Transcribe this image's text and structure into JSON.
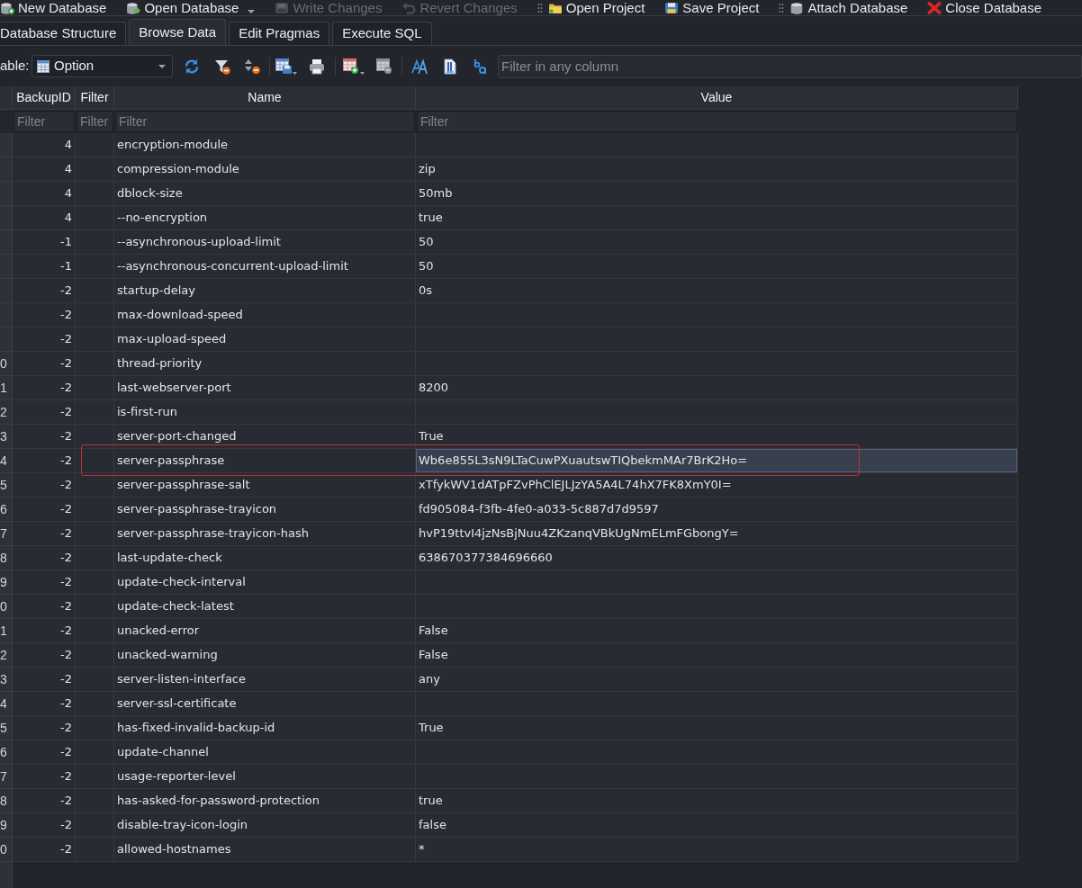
{
  "main_toolbar": {
    "groups": [
      {
        "items": [
          {
            "label": "New Database",
            "disabled": false,
            "dropdown": false
          },
          {
            "label": "Open Database",
            "disabled": false,
            "dropdown": true
          },
          {
            "label": "Write Changes",
            "disabled": true,
            "dropdown": false
          },
          {
            "label": "Revert Changes",
            "disabled": true,
            "dropdown": false
          }
        ]
      },
      {
        "items": [
          {
            "label": "Open Project",
            "disabled": false,
            "dropdown": false
          },
          {
            "label": "Save Project",
            "disabled": false,
            "dropdown": false
          }
        ]
      },
      {
        "items": [
          {
            "label": "Attach Database",
            "disabled": false,
            "dropdown": false
          },
          {
            "label": "Close Database",
            "disabled": false,
            "dropdown": false
          }
        ]
      }
    ]
  },
  "tabs": [
    {
      "label": "Database Structure",
      "selected": false
    },
    {
      "label": "Browse Data",
      "selected": true
    },
    {
      "label": "Edit Pragmas",
      "selected": false
    },
    {
      "label": "Execute SQL",
      "selected": false
    }
  ],
  "browse_toolbar": {
    "table_label": "able:",
    "table_select": {
      "value": "Option"
    },
    "filter": {
      "placeholder": "Filter in any column"
    }
  },
  "table": {
    "columns": [
      {
        "label": "BackupID",
        "filter_placeholder": "Filter"
      },
      {
        "label": "Filter",
        "filter_placeholder": "Filter"
      },
      {
        "label": "Name",
        "filter_placeholder": "Filter"
      },
      {
        "label": "Value",
        "filter_placeholder": "Filter"
      }
    ],
    "rows": [
      {
        "backup_id": "4",
        "name": "encryption-module",
        "selected": false,
        "marked": false
      },
      {
        "backup_id": "4",
        "name": "compression-module",
        "value": "zip",
        "selected": false,
        "marked": false
      },
      {
        "backup_id": "4",
        "name": "dblock-size",
        "value": "50mb",
        "selected": false,
        "marked": false
      },
      {
        "backup_id": "4",
        "name": "--no-encryption",
        "value": "true",
        "selected": false,
        "marked": false
      },
      {
        "backup_id": "-1",
        "name": "--asynchronous-upload-limit",
        "value": "50",
        "selected": false,
        "marked": false
      },
      {
        "backup_id": "-1",
        "name": "--asynchronous-concurrent-upload-limit",
        "value": "50",
        "selected": false,
        "marked": false
      },
      {
        "backup_id": "-2",
        "name": "startup-delay",
        "value": "0s",
        "selected": false,
        "marked": false
      },
      {
        "backup_id": "-2",
        "name": "max-download-speed",
        "selected": false,
        "marked": false
      },
      {
        "backup_id": "-2",
        "name": "max-upload-speed",
        "selected": false,
        "marked": false
      },
      {
        "row_header": "0",
        "backup_id": "-2",
        "name": "thread-priority",
        "selected": false,
        "marked": false
      },
      {
        "row_header": "1",
        "backup_id": "-2",
        "name": "last-webserver-port",
        "value": "8200",
        "selected": false,
        "marked": false
      },
      {
        "row_header": "2",
        "backup_id": "-2",
        "name": "is-first-run",
        "selected": false,
        "marked": false
      },
      {
        "row_header": "3",
        "backup_id": "-2",
        "name": "server-port-changed",
        "value": "True",
        "selected": false,
        "marked": false
      },
      {
        "row_header": "4",
        "backup_id": "-2",
        "name": "server-passphrase",
        "value": "Wb6e855L3sN9LTaCuwPXuautswTIQbekmMAr7BrK2Ho=",
        "selected": true,
        "marked": true
      },
      {
        "row_header": "5",
        "backup_id": "-2",
        "name": "server-passphrase-salt",
        "value": "xTfykWV1dATpFZvPhClEJLJzYA5A4L74hX7FK8XmY0I=",
        "selected": false,
        "marked": false
      },
      {
        "row_header": "6",
        "backup_id": "-2",
        "name": "server-passphrase-trayicon",
        "value": "fd905084-f3fb-4fe0-a033-5c887d7d9597",
        "selected": false,
        "marked": false
      },
      {
        "row_header": "7",
        "backup_id": "-2",
        "name": "server-passphrase-trayicon-hash",
        "value": "hvP19ttvI4jzNsBjNuu4ZKzanqVBkUgNmELmFGbongY=",
        "selected": false,
        "marked": false
      },
      {
        "row_header": "8",
        "backup_id": "-2",
        "name": "last-update-check",
        "value": "638670377384696660",
        "selected": false,
        "marked": false
      },
      {
        "row_header": "9",
        "backup_id": "-2",
        "name": "update-check-interval",
        "selected": false,
        "marked": false
      },
      {
        "row_header": "0",
        "backup_id": "-2",
        "name": "update-check-latest",
        "selected": false,
        "marked": false
      },
      {
        "row_header": "1",
        "backup_id": "-2",
        "name": "unacked-error",
        "value": "False",
        "selected": false,
        "marked": false
      },
      {
        "row_header": "2",
        "backup_id": "-2",
        "name": "unacked-warning",
        "value": "False",
        "selected": false,
        "marked": false
      },
      {
        "row_header": "3",
        "backup_id": "-2",
        "name": "server-listen-interface",
        "value": "any",
        "selected": false,
        "marked": false
      },
      {
        "row_header": "4",
        "backup_id": "-2",
        "name": "server-ssl-certificate",
        "selected": false,
        "marked": false
      },
      {
        "row_header": "5",
        "backup_id": "-2",
        "name": "has-fixed-invalid-backup-id",
        "value": "True",
        "selected": false,
        "marked": false
      },
      {
        "row_header": "6",
        "backup_id": "-2",
        "name": "update-channel",
        "selected": false,
        "marked": false
      },
      {
        "row_header": "7",
        "backup_id": "-2",
        "name": "usage-reporter-level",
        "selected": false,
        "marked": false
      },
      {
        "row_header": "8",
        "backup_id": "-2",
        "name": "has-asked-for-password-protection",
        "value": "true",
        "selected": false,
        "marked": false
      },
      {
        "row_header": "9",
        "backup_id": "-2",
        "name": "disable-tray-icon-login",
        "value": "false",
        "selected": false,
        "marked": false
      },
      {
        "row_header": "0",
        "backup_id": "-2",
        "name": "allowed-hostnames",
        "value": "*",
        "selected": false,
        "marked": false
      }
    ]
  }
}
